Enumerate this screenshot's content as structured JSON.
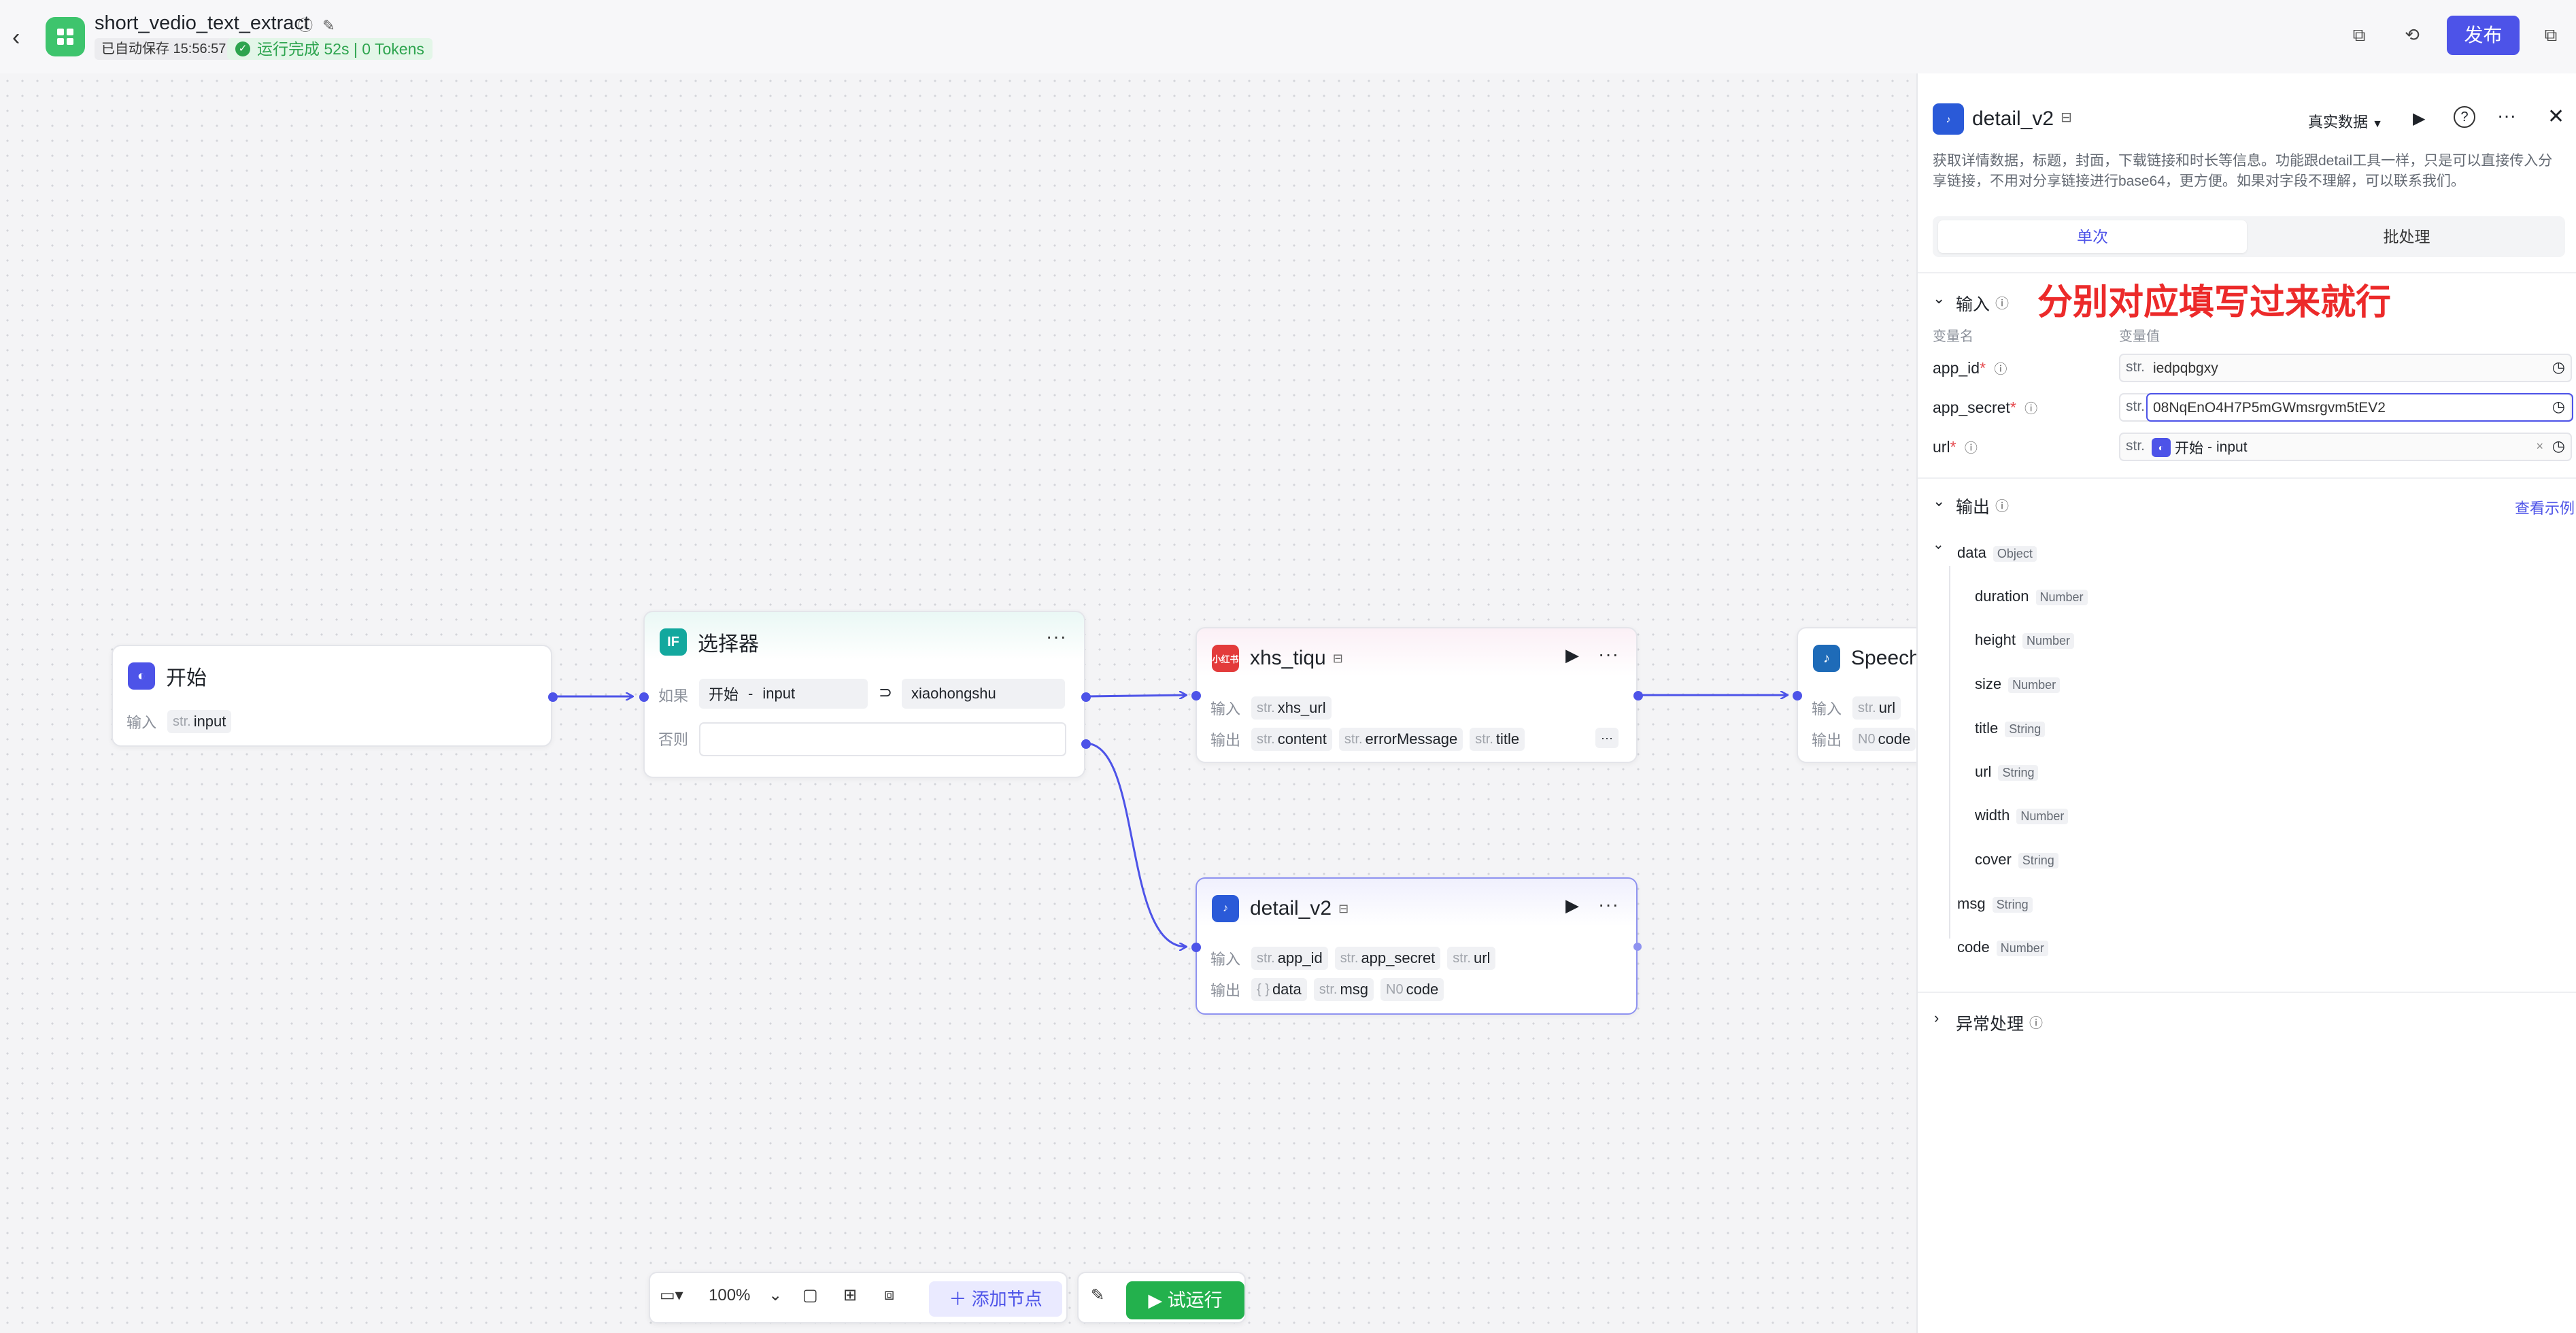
{
  "header": {
    "app_title": "short_vedio_text_extract",
    "autosave": "已自动保存 15:56:57",
    "run_status": "运行完成 52s | 0 Tokens",
    "publish_label": "发布"
  },
  "canvas": {
    "nodes": {
      "start": {
        "title": "开始",
        "input_label": "输入",
        "input_type": "str.",
        "input_var": "input"
      },
      "selector": {
        "title": "选择器",
        "if_label": "如果",
        "else_label": "否则",
        "cond_left_node": "开始",
        "cond_left_sep": "-",
        "cond_left_var": "input",
        "operator": "⊃",
        "cond_right": "xiaohongshu"
      },
      "xhs": {
        "title": "xhs_tiqu",
        "icon_text": "小红书",
        "input_label": "输入",
        "output_label": "输出",
        "inputs": [
          {
            "type": "str.",
            "name": "xhs_url"
          }
        ],
        "outputs": [
          {
            "type": "str.",
            "name": "content"
          },
          {
            "type": "str.",
            "name": "errorMessage"
          },
          {
            "type": "str.",
            "name": "title"
          }
        ],
        "more": "···"
      },
      "speech": {
        "title": "Speech",
        "input_label": "输入",
        "output_label": "输出",
        "inputs": [
          {
            "type": "str.",
            "name": "url"
          }
        ],
        "outputs": [
          {
            "type": "N0",
            "name": "code"
          }
        ]
      },
      "detail": {
        "title": "detail_v2",
        "input_label": "输入",
        "output_label": "输出",
        "inputs": [
          {
            "type": "str.",
            "name": "app_id"
          },
          {
            "type": "str.",
            "name": "app_secret"
          },
          {
            "type": "str.",
            "name": "url"
          }
        ],
        "outputs": [
          {
            "type": "{ }",
            "name": "data"
          },
          {
            "type": "str.",
            "name": "msg"
          },
          {
            "type": "N0",
            "name": "code"
          }
        ]
      }
    }
  },
  "toolbar": {
    "zoom": "100%",
    "add_node_label": "添加节点",
    "test_run_label": "试运行"
  },
  "panel": {
    "title": "detail_v2",
    "data_mode": "真实数据",
    "description": "获取详情数据，标题，封面，下载链接和时长等信息。功能跟detail工具一样，只是可以直接传入分享链接，不用对分享链接进行base64，更方便。如果对字段不理解，可以联系我们。",
    "tab_single": "单次",
    "tab_batch": "批处理",
    "input_section": "输入",
    "annotation": "分别对应填写过来就行",
    "col_var_name": "变量名",
    "col_var_value": "变量值",
    "inputs": [
      {
        "name": "app_id",
        "type": "str.",
        "value": "iedpqbgxy"
      },
      {
        "name": "app_secret",
        "type": "str.",
        "value": "08NqEnO4H7P5mGWmsrgvm5tEV2"
      },
      {
        "name": "url",
        "type": "str.",
        "ref_node": "开始",
        "ref_var": "input",
        "ref_sep": "-"
      }
    ],
    "output_section": "输出",
    "view_example": "查看示例",
    "outputs": {
      "root": {
        "name": "data",
        "type": "Object"
      },
      "children": [
        {
          "name": "duration",
          "type": "Number"
        },
        {
          "name": "height",
          "type": "Number"
        },
        {
          "name": "size",
          "type": "Number"
        },
        {
          "name": "title",
          "type": "String"
        },
        {
          "name": "url",
          "type": "String"
        },
        {
          "name": "width",
          "type": "Number"
        },
        {
          "name": "cover",
          "type": "String"
        }
      ],
      "others": [
        {
          "name": "msg",
          "type": "String"
        },
        {
          "name": "code",
          "type": "Number"
        }
      ]
    },
    "exception_section": "异常处理"
  }
}
